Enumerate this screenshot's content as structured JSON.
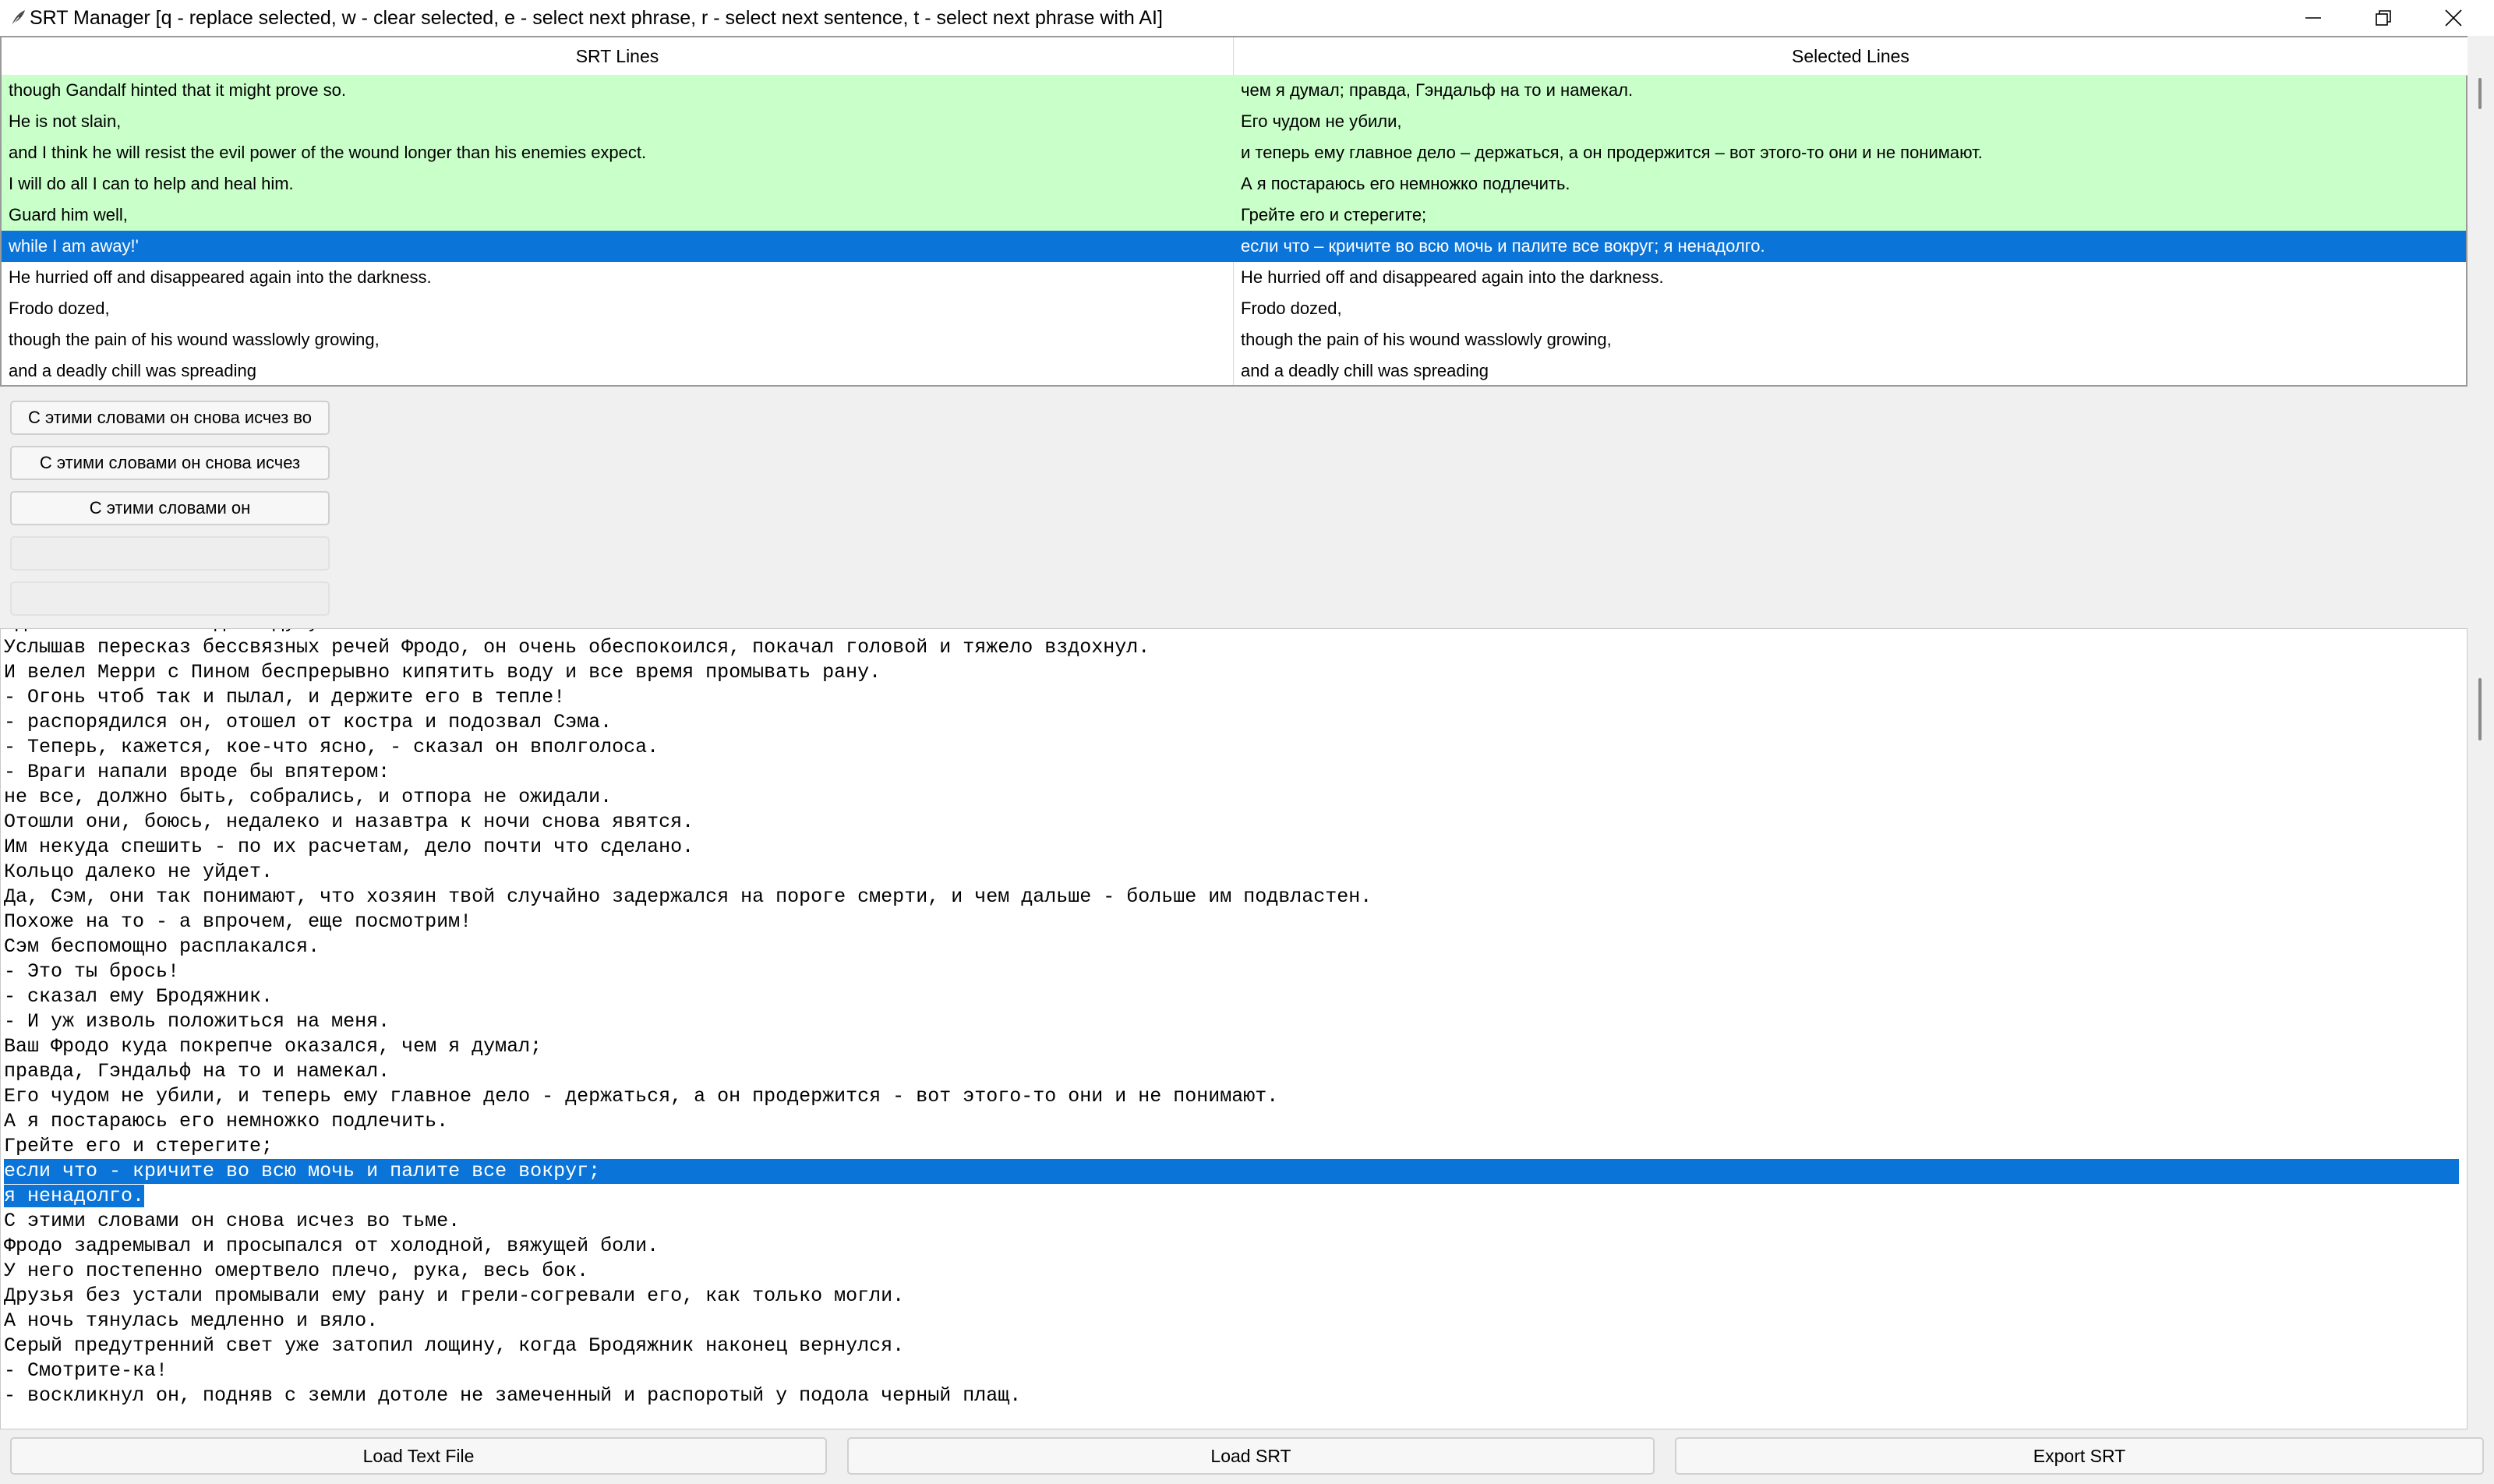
{
  "window": {
    "title": "SRT Manager [q - replace selected, w - clear selected, e - select next phrase, r - select next sentence, t - select next phrase with AI]",
    "icons": [
      "feather-icon",
      "minimize-icon",
      "restore-icon",
      "close-icon"
    ]
  },
  "table": {
    "headers": {
      "srt": "SRT Lines",
      "selected": "Selected Lines"
    },
    "rows": [
      {
        "srt": "though Gandalf hinted that it might prove so.",
        "selected": "чем я думал; правда, Гэндальф на то и намекал.",
        "state": "matched"
      },
      {
        "srt": "He is not slain,",
        "selected": "Его чудом не убили,",
        "state": "matched"
      },
      {
        "srt": "and I think he will resist the evil power of the wound longer than his enemies expect.",
        "selected": "и теперь ему главное дело – держаться, а он продержится – вот этого-то они и не понимают.",
        "state": "matched"
      },
      {
        "srt": "I will do all I can to help and heal him.",
        "selected": "А я постараюсь его немножко подлечить.",
        "state": "matched"
      },
      {
        "srt": "Guard him well,",
        "selected": "Грейте его и стерегите;",
        "state": "matched"
      },
      {
        "srt": "while I am away!'",
        "selected": "если что – кричите во всю мочь и палите все вокруг; я ненадолго.",
        "state": "selected"
      },
      {
        "srt": "He hurried off and disappeared again into the darkness.",
        "selected": "He hurried off and disappeared again into the darkness.",
        "state": "plain"
      },
      {
        "srt": "Frodo dozed,",
        "selected": "Frodo dozed,",
        "state": "plain"
      },
      {
        "srt": "though the pain of his wound wasslowly growing,",
        "selected": "though the pain of his wound wasslowly growing,",
        "state": "plain"
      },
      {
        "srt": "and a deadly chill was spreading",
        "selected": "and a deadly chill was spreading",
        "state": "plain"
      }
    ]
  },
  "phrase_buttons": [
    "С этими словами он снова исчез во",
    "С этими словами он снова исчез",
    "С этими словами он",
    "",
    ""
  ],
  "text": {
    "lines": [
      "Однако поблизости даже духу их нет.",
      "Услышав пересказ бессвязных речей Фродо, он очень обеспокоился, покачал головой и тяжело вздохнул.",
      "И велел Мерри с Пином беспрерывно кипятить воду и все время промывать рану.",
      "- Огонь чтоб так и пылал, и держите его в тепле!",
      "- распорядился он, отошел от костра и подозвал Сэма.",
      "- Теперь, кажется, кое-что ясно, - сказал он вполголоса.",
      "- Враги напали вроде бы впятером:",
      "не все, должно быть, собрались, и отпора не ожидали.",
      "Отошли они, боюсь, недалеко и назавтра к ночи снова явятся.",
      "Им некуда спешить - по их расчетам, дело почти что сделано.",
      "Кольцо далеко не уйдет.",
      "Да, Сэм, они так понимают, что хозяин твой случайно задержался на пороге смерти, и чем дальше - больше им подвластен.",
      "Похоже на то - а впрочем, еще посмотрим!",
      "Сэм беспомощно расплакался.",
      "- Это ты брось!",
      "- сказал ему Бродяжник.",
      "- И уж изволь положиться на меня.",
      "Ваш Фродо куда покрепче оказался, чем я думал;",
      "правда, Гэндальф на то и намекал.",
      "Его чудом не убили, и теперь ему главное дело - держаться, а он продержится - вот этого-то они и не понимают.",
      "А я постараюсь его немножко подлечить.",
      "Грейте его и стерегите;",
      "если что - кричите во всю мочь и палите все вокруг;",
      "я ненадолго.",
      "С этими словами он снова исчез во тьме.",
      "Фродо задремывал и просыпался от холодной, вяжущей боли.",
      "У него постепенно омертвело плечо, рука, весь бок.",
      "Друзья без устали промывали ему рану и грели-согревали его, как только могли.",
      "А ночь тянулась медленно и вяло.",
      "Серый предутренний свет уже затопил лощину, когда Бродяжник наконец вернулся.",
      "- Смотрите-ка!",
      "- воскликнул он, подняв с земли дотоле не замеченный и распоротый у подола черный плащ."
    ],
    "highlighted_full_line": 22,
    "highlighted_partial_line": 23
  },
  "bottom_buttons": {
    "load_text": "Load Text File",
    "load_srt": "Load SRT",
    "export_srt": "Export SRT"
  },
  "colors": {
    "matched_row": "#c9ffc9",
    "selection": "#0a74d8"
  }
}
